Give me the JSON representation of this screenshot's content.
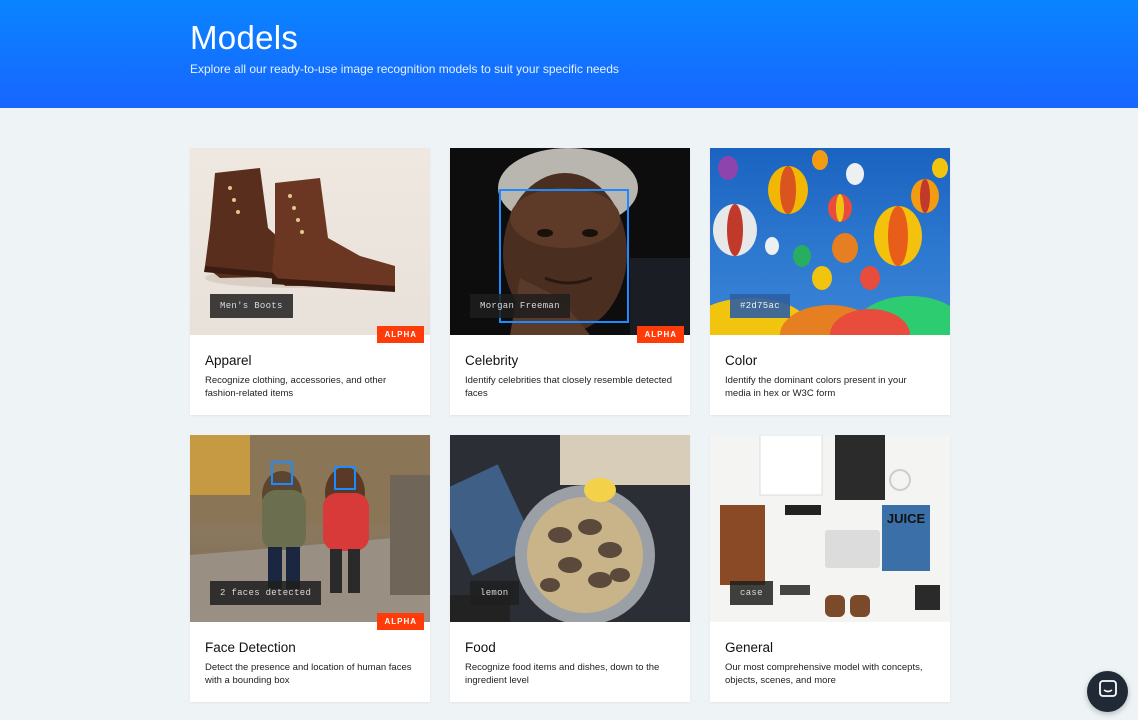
{
  "header": {
    "title": "Models",
    "subtitle": "Explore all our ready-to-use image recognition models to suit your specific needs"
  },
  "cards": [
    {
      "title": "Apparel",
      "description": "Recognize clothing, accessories, and other fashion-related items",
      "tag": "Men's Boots",
      "badge": "ALPHA"
    },
    {
      "title": "Celebrity",
      "description": "Identify celebrities that closely resemble detected faces",
      "tag": "Morgan Freeman",
      "badge": "ALPHA"
    },
    {
      "title": "Color",
      "description": "Identify the dominant colors present in your media in hex or W3C form",
      "tag": "#2d75ac"
    },
    {
      "title": "Face Detection",
      "description": "Detect the presence and location of human faces with a bounding box",
      "tag": "2 faces detected",
      "badge": "ALPHA"
    },
    {
      "title": "Food",
      "description": "Recognize food items and dishes, down to the ingredient level",
      "tag": "lemon"
    },
    {
      "title": "General",
      "description": "Our most comprehensive model with concepts, objects, scenes, and more",
      "tag": "case"
    }
  ],
  "colors": {
    "header": "#0a84ff",
    "badge": "#ff3b0a",
    "background": "#eef3f6"
  },
  "chat_button": {
    "icon": "chat-icon"
  },
  "general_card": {
    "magazine_text": "JUICE"
  }
}
